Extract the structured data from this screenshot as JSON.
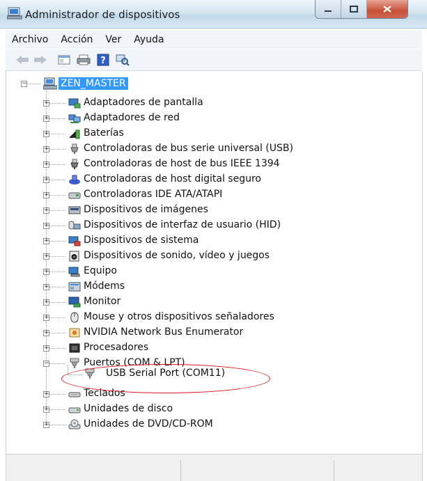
{
  "window": {
    "title": "Administrador de dispositivos"
  },
  "menu": [
    "Archivo",
    "Acción",
    "Ver",
    "Ayuda"
  ],
  "tree": {
    "root": "ZEN_MASTER",
    "categories": [
      {
        "label": "Adaptadores de pantalla",
        "icon": "display-adapter-icon"
      },
      {
        "label": "Adaptadores de red",
        "icon": "network-adapter-icon"
      },
      {
        "label": "Baterías",
        "icon": "battery-icon"
      },
      {
        "label": "Controladoras de bus serie universal (USB)",
        "icon": "usb-icon"
      },
      {
        "label": "Controladoras de host de bus IEEE 1394",
        "icon": "ieee1394-icon"
      },
      {
        "label": "Controladoras de host digital seguro",
        "icon": "sd-host-icon"
      },
      {
        "label": "Controladoras IDE ATA/ATAPI",
        "icon": "ide-controller-icon"
      },
      {
        "label": "Dispositivos de imágenes",
        "icon": "imaging-device-icon"
      },
      {
        "label": "Dispositivos de interfaz de usuario (HID)",
        "icon": "hid-icon"
      },
      {
        "label": "Dispositivos de sistema",
        "icon": "system-device-icon"
      },
      {
        "label": "Dispositivos de sonido, vídeo y juegos",
        "icon": "sound-icon"
      },
      {
        "label": "Equipo",
        "icon": "computer-icon"
      },
      {
        "label": "Módems",
        "icon": "modem-icon"
      },
      {
        "label": "Monitor",
        "icon": "monitor-icon"
      },
      {
        "label": "Mouse y otros dispositivos señaladores",
        "icon": "mouse-icon"
      },
      {
        "label": "NVIDIA Network Bus Enumerator",
        "icon": "nvidia-bus-icon"
      },
      {
        "label": "Procesadores",
        "icon": "processor-icon"
      },
      {
        "label": "Puertos (COM & LPT)",
        "icon": "port-icon"
      },
      {
        "label": "Teclados",
        "icon": "keyboard-icon"
      },
      {
        "label": "Unidades de disco",
        "icon": "disk-drive-icon"
      },
      {
        "label": "Unidades de DVD/CD-ROM",
        "icon": "dvd-drive-icon"
      }
    ],
    "expanded_child": {
      "label": "USB Serial Port (COM11)",
      "icon": "port-icon"
    }
  },
  "colors": {
    "selection": "#3399ff",
    "highlight_ellipse": "#e0141c"
  }
}
